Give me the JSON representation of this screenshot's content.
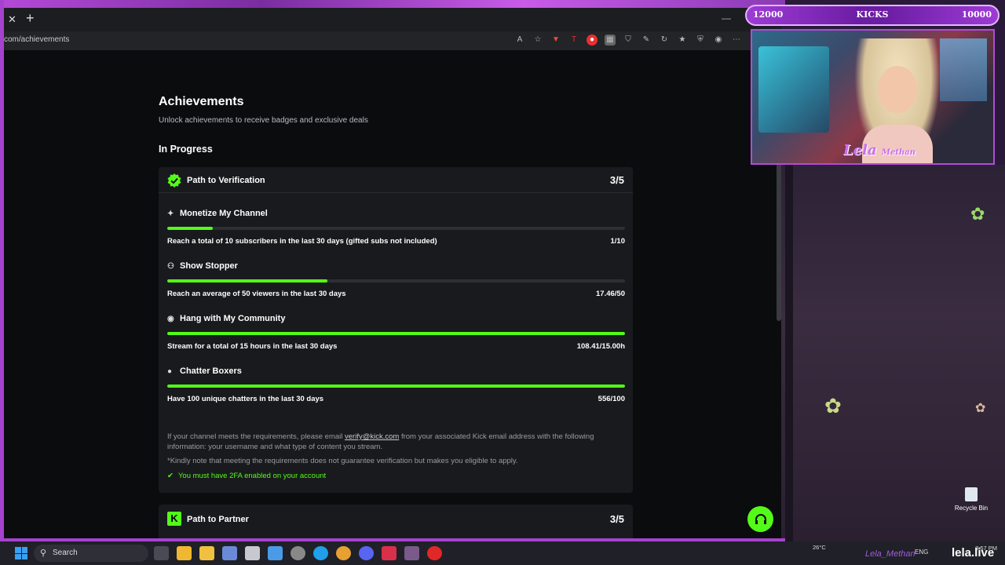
{
  "browser": {
    "url": "com/achievements"
  },
  "page": {
    "title": "Achievements",
    "subtitle": "Unlock achievements to receive badges and exclusive deals",
    "section_title": "In Progress"
  },
  "verification_card": {
    "title": "Path to Verification",
    "count": "3/5",
    "achievements": [
      {
        "title": "Monetize My Channel",
        "icon": "sparkle-icon",
        "description": "Reach a total of 10 subscribers in the last 30 days (gifted subs not included)",
        "value": "1/10",
        "progress": 0.1
      },
      {
        "title": "Show Stopper",
        "icon": "users-icon",
        "description": "Reach an average of 50 viewers in the last 30 days",
        "value": "17.46/50",
        "progress": 0.35
      },
      {
        "title": "Hang with My Community",
        "icon": "broadcast-icon",
        "description": "Stream for a total of 15 hours in the last 30 days",
        "value": "108.41/15.00h",
        "progress": 1.0
      },
      {
        "title": "Chatter Boxers",
        "icon": "chat-icon",
        "description": "Have 100 unique chatters in the last 30 days",
        "value": "556/100",
        "progress": 1.0
      }
    ],
    "note_prefix": "If your channel meets the requirements, please email ",
    "note_email": "verify@kick.com",
    "note_suffix": " from your associated Kick email address with the following information: your username and what type of content you stream.",
    "disclaimer": "*Kindly note that meeting the requirements does not guarantee verification but makes you eligible to apply.",
    "requirement": "You must have 2FA enabled on your account"
  },
  "partner_card": {
    "title": "Path to Partner",
    "count": "3/5",
    "logo_letter": "K"
  },
  "overlay": {
    "goal_left": "12000",
    "goal_center": "KICKS",
    "goal_right": "10000",
    "cam_name": "Lela",
    "cam_name2": "Methan",
    "brand": "lela.live",
    "brand_user": "Lela_Methan"
  },
  "desktop": {
    "recycle_bin": "Recycle Bin"
  },
  "taskbar": {
    "search": "Search",
    "weather_temp": "26°C",
    "language": "ENG",
    "time": "8:57 PM"
  },
  "colors": {
    "accent": "#53fc18",
    "overlay_purple": "#a642cf"
  }
}
